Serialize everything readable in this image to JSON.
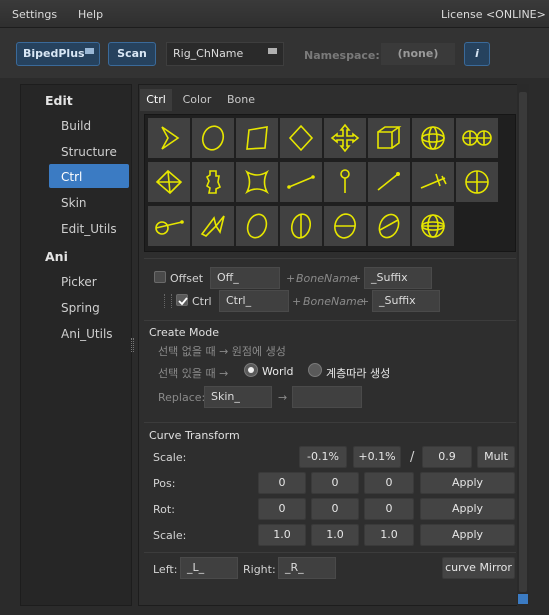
{
  "menu": {
    "settings": "Settings",
    "help": "Help",
    "license": "License <ONLINE>"
  },
  "toolbar": {
    "biped_label": "BipedPlus",
    "scan_label": "Scan",
    "rig_name": "Rig_ChName",
    "namespace_label": "Namespace:",
    "namespace_value": "(none)",
    "info_label": "i"
  },
  "sidebar": {
    "groups": [
      {
        "title": "Edit",
        "items": [
          "Build",
          "Structure",
          "Ctrl",
          "Skin",
          "Edit_Utils"
        ]
      },
      {
        "title": "Ani",
        "items": [
          "Picker",
          "Spring",
          "Ani_Utils"
        ]
      }
    ],
    "selected": "Ctrl"
  },
  "tabs": [
    "Ctrl",
    "Color",
    "Bone"
  ],
  "active_tab": "Ctrl",
  "shape_icons": [
    "arrow-shape-icon",
    "circle-shape-icon",
    "square-shape-icon",
    "diamond-shape-icon",
    "four-arrows-shape-icon",
    "cube-shape-icon",
    "sphere-shape-icon",
    "double-sphere-shape-icon",
    "pyramid-shape-icon",
    "gear-shape-icon",
    "star-square-shape-icon",
    "line-ball-shape-icon",
    "pin-shape-icon",
    "stick-shape-icon",
    "cross-line-shape-icon",
    "circle-cross-shape-icon",
    "circle-line-shape-icon",
    "zigzag-arrow-shape-icon",
    "ellipse-shape-icon",
    "ring-ellipse-shape-icon",
    "half-circle-shape-icon",
    "split-ellipse-shape-icon",
    "globe-shape-icon"
  ],
  "naming": {
    "offset": {
      "checked": false,
      "label": "Offset",
      "value": "Off_",
      "bone": "BoneName",
      "suffix": "_Suffix"
    },
    "ctrl": {
      "checked": true,
      "label": "Ctrl",
      "value": "Ctrl_",
      "bone": "BoneName",
      "suffix": "_Suffix"
    },
    "plus": "+"
  },
  "create_mode": {
    "title": "Create Mode",
    "no_selection": "선택 없을 때 → 원점에 생성",
    "with_selection": "선택 있을 때 →",
    "option_world": "World",
    "option_hierarchy": "계층따라 생성",
    "replace_label": "Replace:",
    "replace_from": "Skin_",
    "arrow": "→",
    "replace_to": ""
  },
  "curve_transform": {
    "title": "Curve Transform",
    "scale_label": "Scale:",
    "minus_btn": "-0.1%",
    "plus_btn": "+0.1%",
    "slash": "/",
    "mult_value": "0.9",
    "mult_btn": "Mult",
    "rows": [
      {
        "label": "Pos:",
        "x": "0",
        "y": "0",
        "z": "0",
        "apply": "Apply"
      },
      {
        "label": "Rot:",
        "x": "0",
        "y": "0",
        "z": "0",
        "apply": "Apply"
      },
      {
        "label": "Scale:",
        "x": "1.0",
        "y": "1.0",
        "z": "1.0",
        "apply": "Apply"
      }
    ],
    "left_label": "Left:",
    "left_value": "_L_",
    "right_label": "Right:",
    "right_value": "_R_",
    "mirror_btn": "curve Mirror"
  },
  "colors": {
    "accent": "#3b7bc3",
    "curve": "#e6e600",
    "panel": "#2e2e2e"
  }
}
